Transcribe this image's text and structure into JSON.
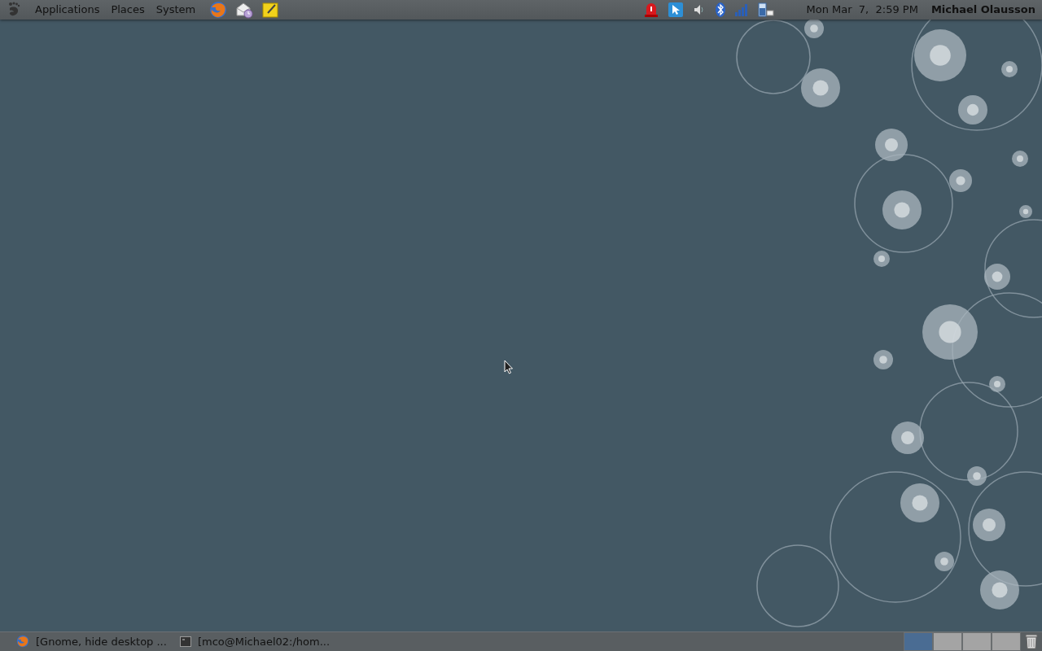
{
  "top_panel": {
    "menus": [
      "Applications",
      "Places",
      "System"
    ],
    "clock": "Mon Mar  7,  2:59 PM",
    "user": "Michael Olausson"
  },
  "bottom_panel": {
    "windows": [
      {
        "label": "[Gnome, hide desktop ...",
        "kind": "browser"
      },
      {
        "label": "[mco@Michael02:/hom...",
        "kind": "terminal"
      }
    ],
    "workspaces": [
      {
        "selected": true
      },
      {
        "selected": false
      },
      {
        "selected": false
      },
      {
        "selected": false
      }
    ]
  }
}
